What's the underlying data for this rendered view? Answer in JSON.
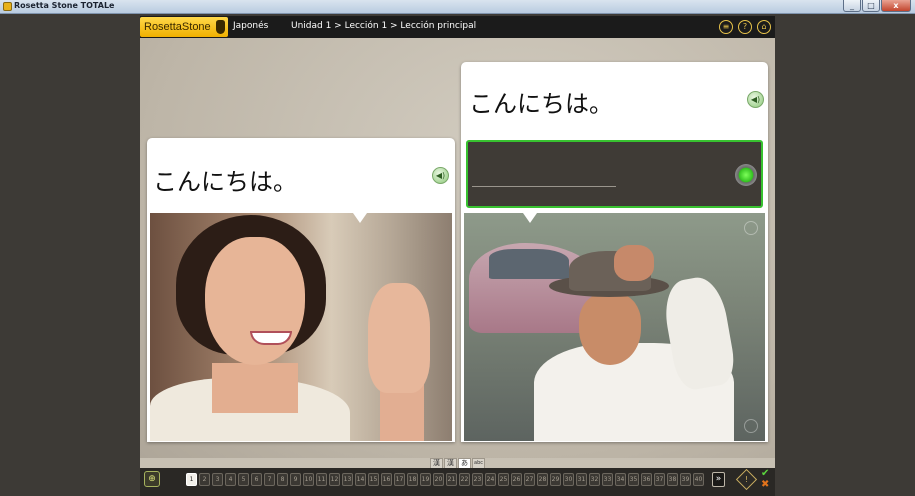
{
  "window": {
    "title": "Rosetta Stone TOTALe",
    "buttons": [
      "_",
      "□",
      "x"
    ]
  },
  "header": {
    "logo_text": "Rosetta",
    "logo_text_bold": "Stone",
    "language": "Japonés",
    "breadcrumb": "Unidad 1 > Lección 1 > Lección principal",
    "icons": [
      "menu",
      "?",
      "⌂"
    ]
  },
  "cards": {
    "left": {
      "phrase": "こんにちは。",
      "speaker_glyph": "◀)"
    },
    "right": {
      "phrase": "こんにちは。",
      "speaker_glyph": "◀)"
    }
  },
  "script_tabs": [
    "漢",
    "漢",
    "あ",
    "abc"
  ],
  "footer": {
    "zoom_glyph": "⊕",
    "screens": [
      "1",
      "2",
      "3",
      "4",
      "5",
      "6",
      "7",
      "8",
      "9",
      "10",
      "11",
      "12",
      "13",
      "14",
      "15",
      "16",
      "17",
      "18",
      "19",
      "20",
      "21",
      "22",
      "23",
      "24",
      "25",
      "26",
      "27",
      "28",
      "29",
      "30",
      "31",
      "32",
      "33",
      "34",
      "35",
      "36",
      "37",
      "38",
      "39",
      "40"
    ],
    "next_glyph": "»",
    "hint_glyph": "!",
    "check_glyph": "✔",
    "x_glyph": "✖"
  },
  "colors": {
    "accent_green": "#38c230",
    "logo_yellow": "#f0b000"
  }
}
